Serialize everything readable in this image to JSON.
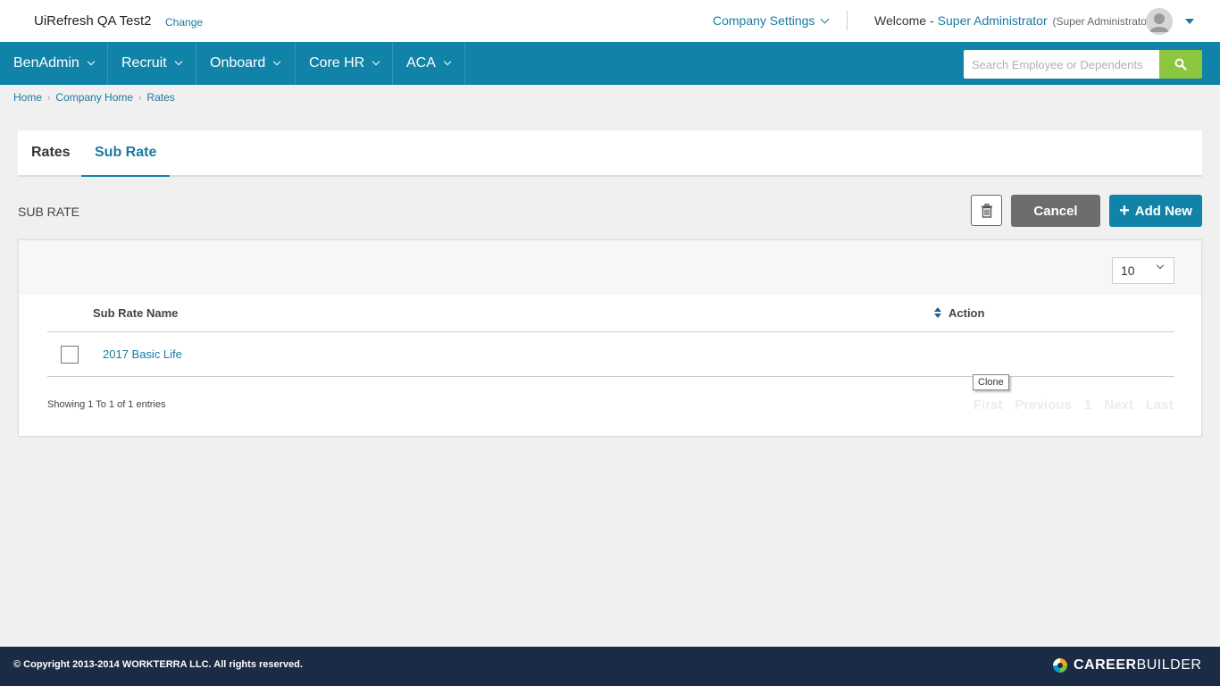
{
  "header": {
    "company_name": "UiRefresh QA Test2",
    "change_label": "Change",
    "company_settings_label": "Company Settings",
    "welcome_label": "Welcome -",
    "user_name": "Super Administrator",
    "user_role": "(Super Administrator)"
  },
  "nav": {
    "items": [
      {
        "label": "BenAdmin"
      },
      {
        "label": "Recruit"
      },
      {
        "label": "Onboard"
      },
      {
        "label": "Core HR"
      },
      {
        "label": "ACA"
      }
    ],
    "search_placeholder": "Search Employee or Dependents"
  },
  "breadcrumb": [
    "Home",
    "Company Home",
    "Rates"
  ],
  "tabs": [
    {
      "label": "Rates",
      "active": false
    },
    {
      "label": "Sub Rate",
      "active": true
    }
  ],
  "section": {
    "title": "SUB RATE",
    "cancel_label": "Cancel",
    "add_label": "Add New"
  },
  "table": {
    "page_size": "10",
    "columns": [
      "Sub Rate Name",
      "Action"
    ],
    "rows": [
      {
        "name": "2017 Basic Life"
      }
    ],
    "showing_text": "Showing 1 To 1 of 1 entries",
    "pager": [
      "First",
      "Previous",
      "1",
      "Next",
      "Last"
    ],
    "tooltip": "Clone"
  },
  "footer": {
    "copyright": "© Copyright 2013-2014 WORKTERRA LLC. All rights reserved.",
    "logo_bold": "CAREER",
    "logo_light": "BUILDER"
  },
  "colors": {
    "nav_bg": "#1183a8",
    "link": "#1a7aa3",
    "search_button": "#8cc63f",
    "footer_bg": "#1b2a45",
    "cancel_bg": "#6d6d6d"
  }
}
